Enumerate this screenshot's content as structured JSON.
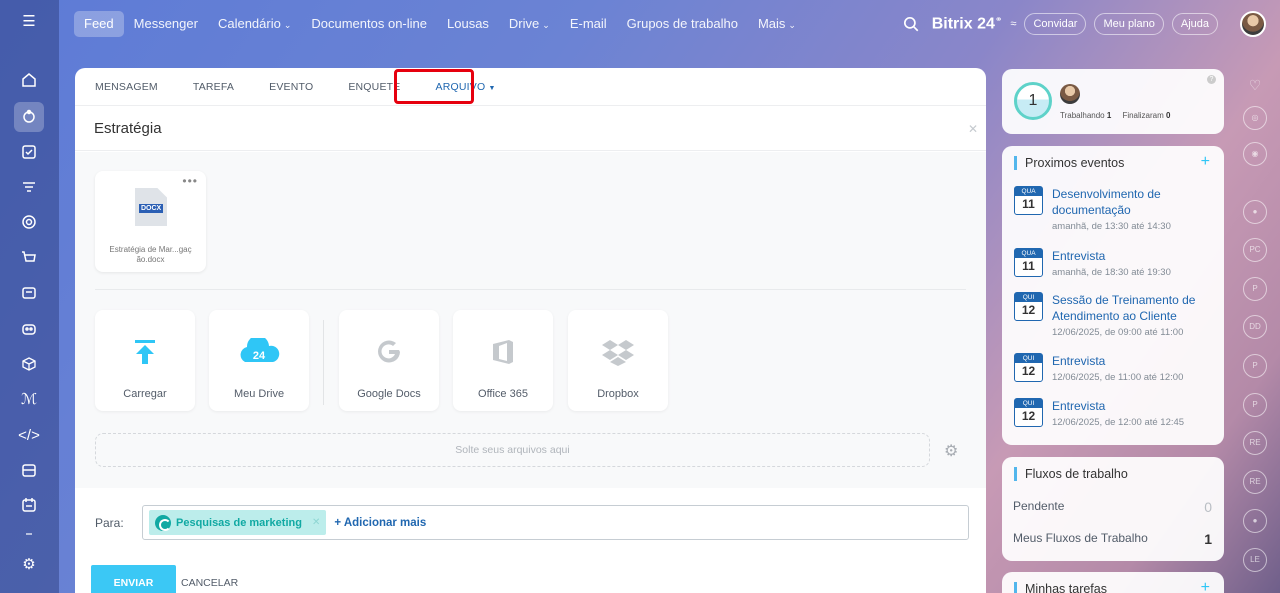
{
  "topnav": {
    "items": [
      {
        "label": "Feed",
        "active": true,
        "dropdown": false
      },
      {
        "label": "Messenger",
        "dropdown": false
      },
      {
        "label": "Calendário",
        "dropdown": true
      },
      {
        "label": "Documentos on-line",
        "dropdown": false
      },
      {
        "label": "Lousas",
        "dropdown": false
      },
      {
        "label": "Drive",
        "dropdown": true
      },
      {
        "label": "E-mail",
        "dropdown": false
      },
      {
        "label": "Grupos de trabalho",
        "dropdown": false
      },
      {
        "label": "Mais",
        "dropdown": true
      }
    ],
    "brand": "Bitrix",
    "brand_num": "24",
    "invite": "Convidar",
    "plan": "Meu plano",
    "help": "Ajuda"
  },
  "composer": {
    "tabs": [
      "MENSAGEM",
      "TAREFA",
      "EVENTO",
      "ENQUETE",
      "ARQUIVO"
    ],
    "active_tab": "ARQUIVO",
    "title": "Estratégia",
    "file": {
      "name": "Estratégia de Mar...gaç ão.docx",
      "type": "DOCX"
    },
    "sources": [
      {
        "label": "Carregar",
        "icon": "upload-icon"
      },
      {
        "label": "Meu Drive",
        "icon": "cloud-24-icon"
      },
      {
        "label": "Google Docs",
        "icon": "google-icon"
      },
      {
        "label": "Office 365",
        "icon": "office-icon"
      },
      {
        "label": "Dropbox",
        "icon": "dropbox-icon"
      }
    ],
    "dropzone": "Solte seus arquivos aqui",
    "to_label": "Para:",
    "recipient": "Pesquisas de marketing",
    "add_more": "+ Adicionar mais",
    "send": "ENVIAR",
    "cancel": "CANCELAR"
  },
  "work_widget": {
    "count": "1",
    "working_label": "Trabalhando",
    "working": "1",
    "finished_label": "Finalizaram",
    "finished": "0"
  },
  "events": {
    "title": "Proximos eventos",
    "items": [
      {
        "day": "QUA",
        "num": "11",
        "title": "Desenvolvimento de documentação",
        "time": "amanhã, de 13:30 até 14:30"
      },
      {
        "day": "QUA",
        "num": "11",
        "title": "Entrevista",
        "time": "amanhã, de 18:30 até 19:30"
      },
      {
        "day": "QUI",
        "num": "12",
        "title": "Sessão de Treinamento de Atendimento ao Cliente",
        "time": "12/06/2025, de 09:00 até 11:00"
      },
      {
        "day": "QUI",
        "num": "12",
        "title": "Entrevista",
        "time": "12/06/2025, de 11:00 até 12:00"
      },
      {
        "day": "QUI",
        "num": "12",
        "title": "Entrevista",
        "time": "12/06/2025, de 12:00 até 12:45"
      }
    ]
  },
  "flows": {
    "title": "Fluxos de trabalho",
    "pending_label": "Pendente",
    "pending": "0",
    "mine_label": "Meus Fluxos de Trabalho",
    "mine": "1"
  },
  "tasks": {
    "title": "Minhas tarefas"
  },
  "right_rail": [
    "PC",
    "P",
    "DD",
    "P",
    "P",
    "RE",
    "RE",
    "LE"
  ]
}
